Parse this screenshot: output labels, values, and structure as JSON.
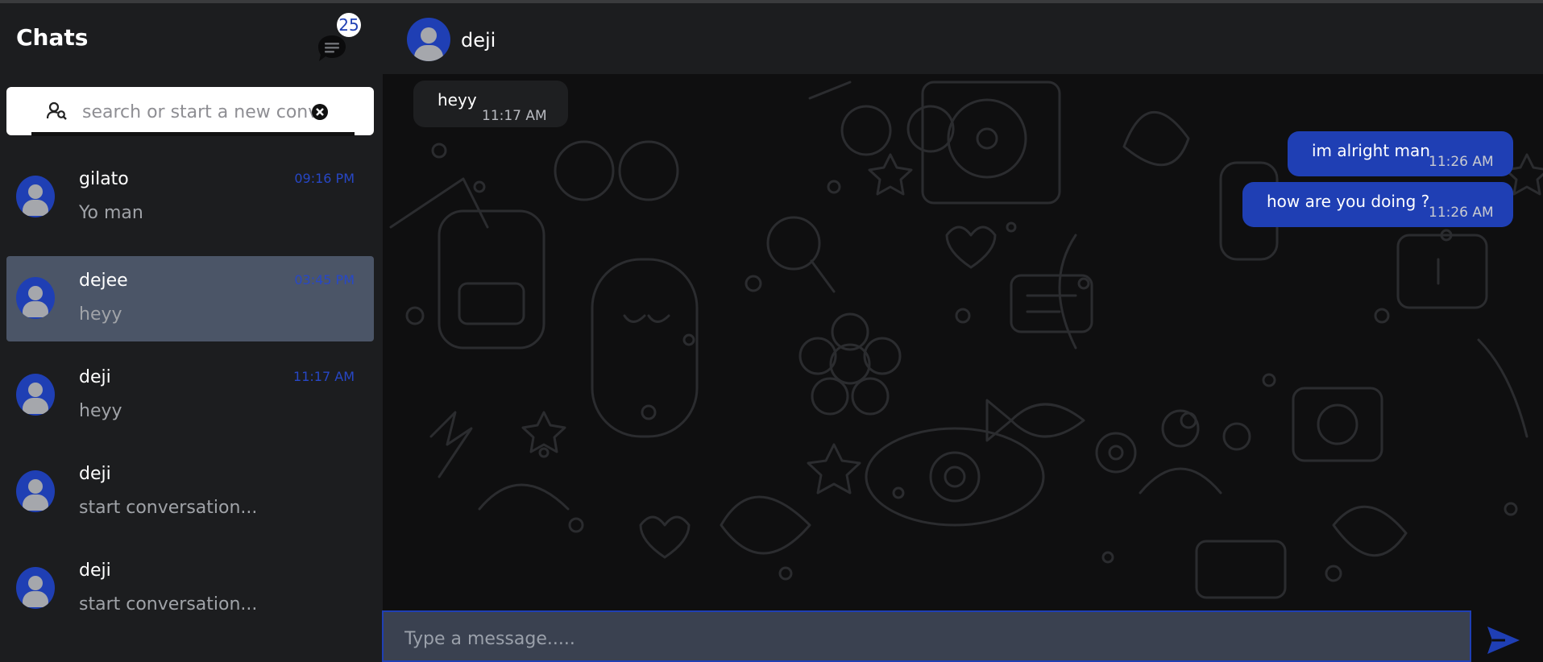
{
  "sidebar": {
    "title": "Chats",
    "unread_badge": "25",
    "chat_icon": "chat-bubble-icon",
    "search": {
      "placeholder": "search or start a new conversation",
      "value": "",
      "icon": "user-search-icon",
      "clear_icon": "clear-icon"
    },
    "chats": [
      {
        "name": "gilato",
        "preview": "Yo man",
        "time": "09:16 PM",
        "active": false
      },
      {
        "name": "dejee",
        "preview": "heyy",
        "time": "03:45 PM",
        "active": true
      },
      {
        "name": "deji",
        "preview": "heyy",
        "time": "11:17 AM",
        "active": false
      },
      {
        "name": "deji",
        "preview": "start conversation...",
        "time": "",
        "active": false
      },
      {
        "name": "deji",
        "preview": "start conversation...",
        "time": "",
        "active": false
      }
    ]
  },
  "conversation": {
    "contact_name": "deji",
    "messages": [
      {
        "direction": "incoming",
        "text": "heyy",
        "time": "11:17 AM"
      },
      {
        "direction": "outgoing",
        "text": "im alright man",
        "time": "11:26 AM"
      },
      {
        "direction": "outgoing",
        "text": "how are you doing ?",
        "time": "11:26 AM"
      }
    ]
  },
  "composer": {
    "placeholder": "Type a message.....",
    "value": "",
    "send_icon": "send-icon"
  },
  "colors": {
    "accent": "#1f3fb4",
    "sidebar_bg": "#1c1d1f",
    "chat_bg": "#0f0f10",
    "active_item": "#4b5567",
    "time_text": "#2747c6"
  }
}
